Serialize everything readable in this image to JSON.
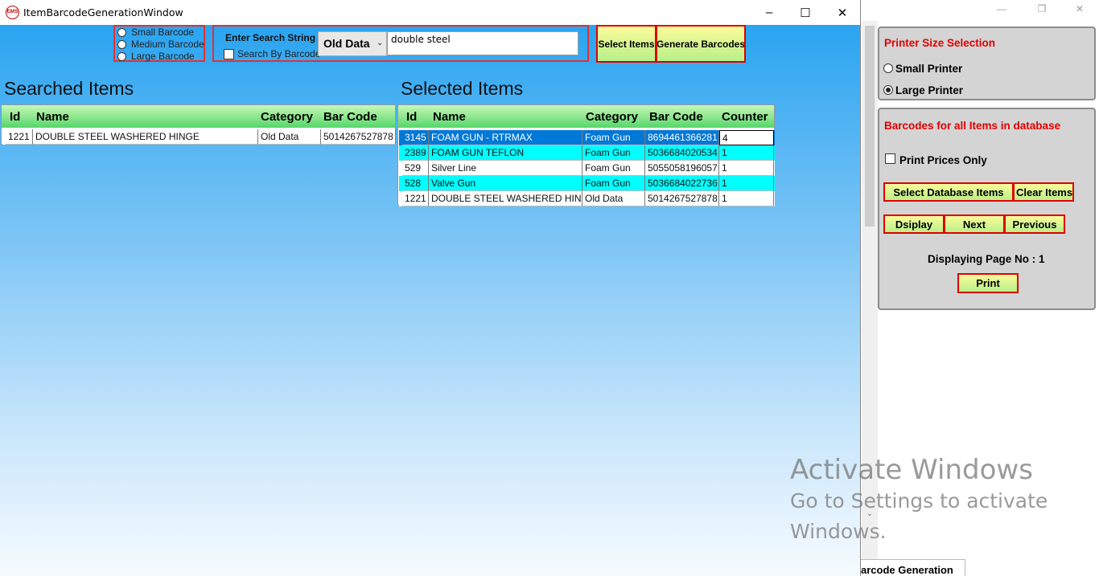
{
  "window": {
    "title": "ItemBarcodeGenerationWindow",
    "icon_text": "EMS",
    "minimize": "–",
    "maximize": "☐",
    "close": "✕"
  },
  "barcode_size": {
    "options": [
      "Small Barcode",
      "Medium Barcode",
      "Large Barcode"
    ]
  },
  "search": {
    "label": "Enter Search String",
    "by_barcode_label": "Search By Barcode",
    "category_selected": "Old Data",
    "query": "double steel"
  },
  "buttons": {
    "select_items": "Select Items",
    "generate_barcodes": "Generate Barcodes"
  },
  "searched_items": {
    "title": "Searched Items",
    "headers": [
      "Id",
      "Name",
      "Category",
      "Bar Code"
    ],
    "rows": [
      [
        "1221",
        " DOUBLE STEEL WASHERED HINGE",
        "Old Data",
        "5014267527878"
      ]
    ]
  },
  "selected_items": {
    "title": "Selected Items",
    "headers": [
      "Id",
      "Name",
      "Category",
      "Bar Code",
      "Counter"
    ],
    "rows": [
      [
        "3145",
        "FOAM GUN -  RTRMAX",
        "Foam Gun",
        "8694461366281",
        "4"
      ],
      [
        "2389",
        "FOAM GUN TEFLON",
        "Foam Gun",
        "5036684020534",
        "1"
      ],
      [
        "529",
        "Silver Line",
        "Foam Gun",
        "5055058196057",
        "1"
      ],
      [
        "528",
        "Valve Gun",
        "Foam Gun",
        "5036684022736",
        "1"
      ],
      [
        "1221",
        " DOUBLE STEEL WASHERED HINGE",
        "Old Data",
        "5014267527878",
        "1"
      ]
    ]
  },
  "side_panel": {
    "printer_title": "Printer Size Selection",
    "small_printer": "Small Printer",
    "large_printer": "Large Printer",
    "db_title": "Barcodes for all Items in database",
    "print_prices_only": "Print Prices Only",
    "select_db_items": "Select Database Items",
    "clear_items": "Clear Items",
    "display": "Dsiplay",
    "next": "Next",
    "previous": "Previous",
    "page_info": "Displaying Page No : 1",
    "print": "Print",
    "tab_label": "arcode Generation",
    "scroll_down": "⌄",
    "bg_minimize": "—",
    "bg_restore": "❐",
    "bg_close": "✕"
  },
  "watermark": {
    "line1": "Activate Windows",
    "line2": "Go to Settings to activate",
    "line3": "Windows."
  },
  "colors": {
    "accent_red": "#e00000",
    "grid_header_green": "#56d66a",
    "selected_row": "#0078d7",
    "cyan_row": "#00ffff"
  }
}
